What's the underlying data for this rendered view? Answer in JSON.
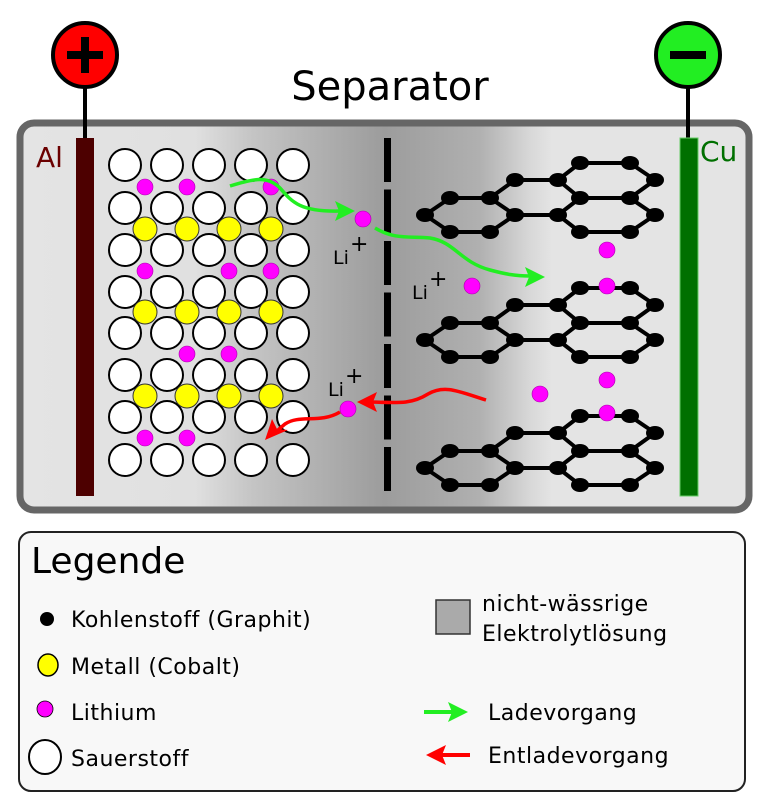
{
  "title": "Separator",
  "electrodes": {
    "positive": {
      "symbol": "+",
      "label": "Al",
      "color": "#ff0000",
      "bar_color": "#4d0000",
      "label_color": "#6b0000"
    },
    "negative": {
      "symbol": "−",
      "label": "Cu",
      "color": "#22ee22",
      "bar_color": "#007000",
      "label_color": "#007000"
    }
  },
  "ion_labels": {
    "li": "Li",
    "plus": "+"
  },
  "colors": {
    "carbon": "#000000",
    "cobalt": "#ffff00",
    "lithium": "#ff00ff",
    "oxygen": "#ffffff",
    "electrolyte": "#aaaaaa",
    "charge_arrow": "#22ee22",
    "discharge_arrow": "#ff0000"
  },
  "legend": {
    "title": "Legende",
    "carbon": "Kohlenstoff (Graphit)",
    "cobalt": "Metall (Cobalt)",
    "lithium": "Lithium",
    "oxygen": "Sauerstoff",
    "electrolyte_line1": "nicht-wässrige",
    "electrolyte_line2": "Elektrolytlösung",
    "charge": "Ladevorgang",
    "discharge": "Entladevorgang"
  }
}
